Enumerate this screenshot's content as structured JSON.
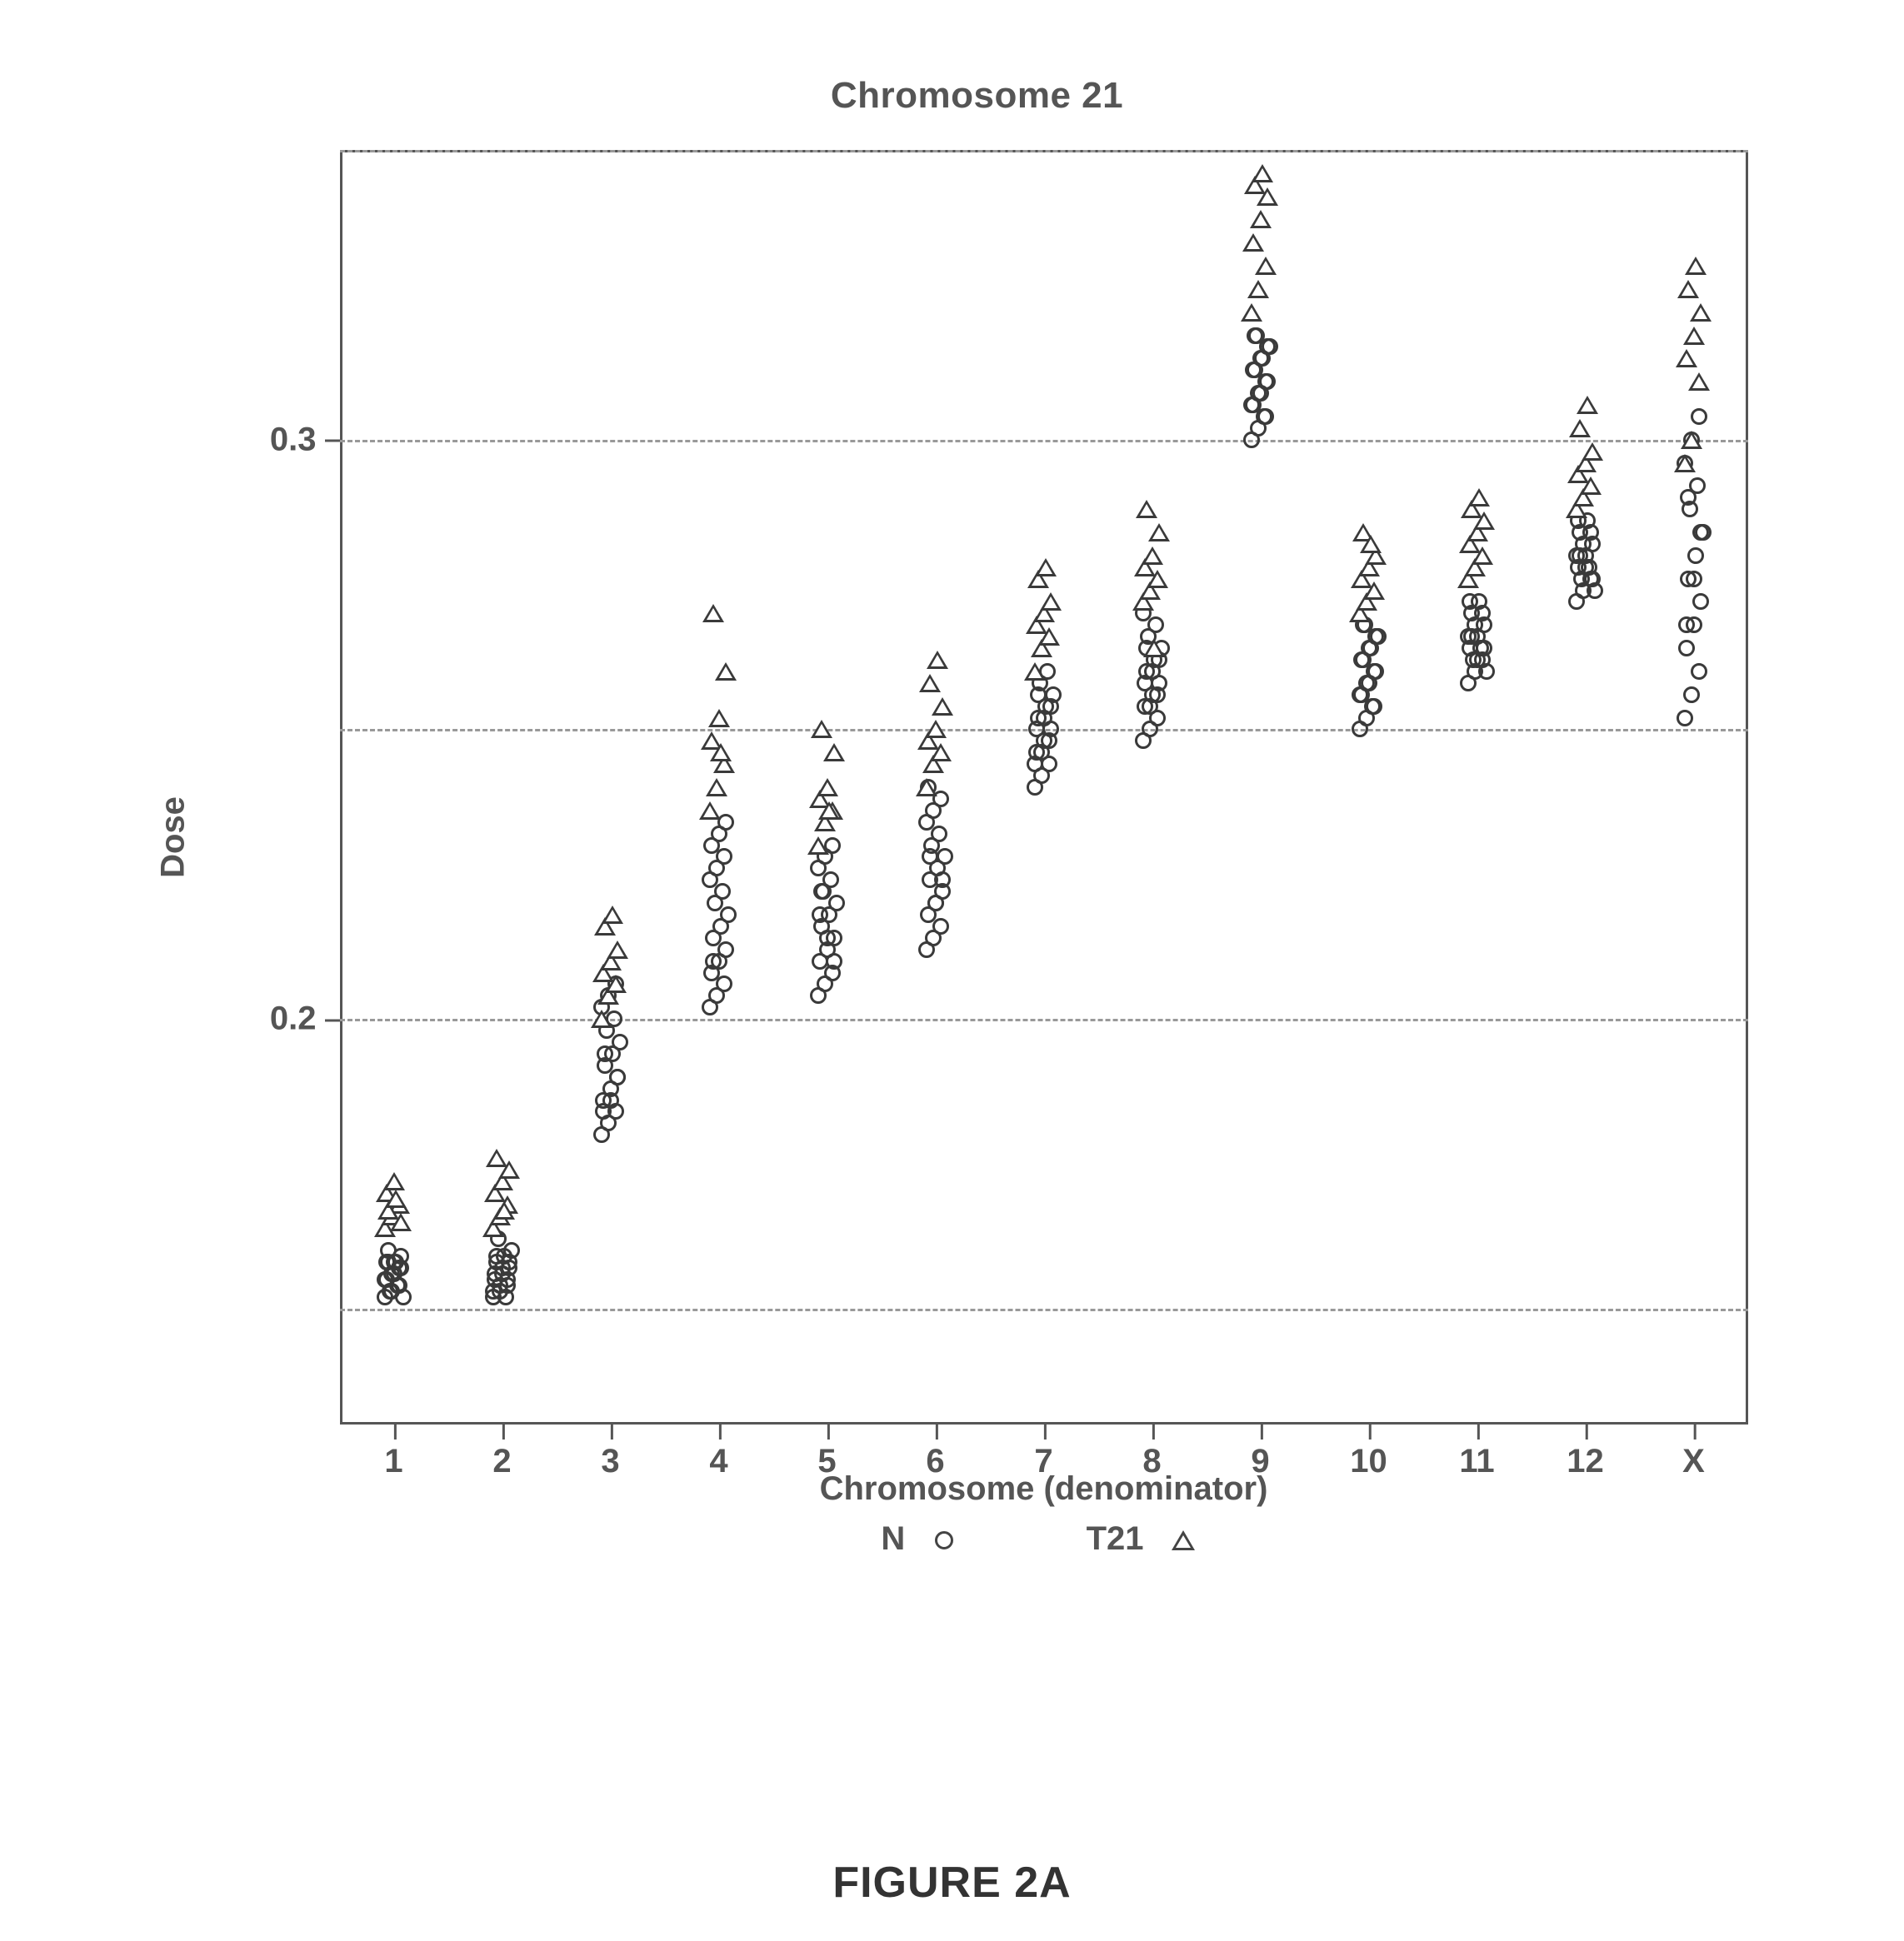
{
  "chart_data": {
    "type": "scatter",
    "title": "Chromosome 21",
    "xlabel": "Chromosome (denominator)",
    "ylabel": "Dose",
    "ylim": [
      0.13,
      0.35
    ],
    "y_gridlines": [
      0.15,
      0.2,
      0.25,
      0.3,
      0.35
    ],
    "y_ticks": [
      {
        "value": 0.2,
        "label": "0.2"
      },
      {
        "value": 0.3,
        "label": "0.3"
      }
    ],
    "categories": [
      "1",
      "2",
      "3",
      "4",
      "5",
      "6",
      "7",
      "8",
      "9",
      "10",
      "11",
      "12",
      "X"
    ],
    "series": [
      {
        "name": "N",
        "marker": "circle",
        "values_by_category": {
          "1": [
            0.152,
            0.153,
            0.154,
            0.155,
            0.156,
            0.157,
            0.158,
            0.158,
            0.152,
            0.153,
            0.154,
            0.155,
            0.156,
            0.157,
            0.158,
            0.158,
            0.159,
            0.16
          ],
          "2": [
            0.152,
            0.153,
            0.154,
            0.155,
            0.156,
            0.157,
            0.158,
            0.159,
            0.16,
            0.162,
            0.152,
            0.153,
            0.154,
            0.155,
            0.156,
            0.157,
            0.158,
            0.159
          ],
          "3": [
            0.18,
            0.182,
            0.184,
            0.186,
            0.188,
            0.19,
            0.192,
            0.194,
            0.196,
            0.198,
            0.2,
            0.202,
            0.204,
            0.206,
            0.184,
            0.186,
            0.19,
            0.194
          ],
          "4": [
            0.202,
            0.204,
            0.206,
            0.208,
            0.21,
            0.212,
            0.214,
            0.216,
            0.218,
            0.22,
            0.222,
            0.224,
            0.226,
            0.228,
            0.23,
            0.232,
            0.234,
            0.21
          ],
          "5": [
            0.204,
            0.206,
            0.208,
            0.21,
            0.212,
            0.214,
            0.216,
            0.218,
            0.22,
            0.222,
            0.224,
            0.226,
            0.228,
            0.23,
            0.218,
            0.214,
            0.21,
            0.222
          ],
          "6": [
            0.212,
            0.214,
            0.216,
            0.218,
            0.22,
            0.222,
            0.224,
            0.226,
            0.228,
            0.23,
            0.232,
            0.234,
            0.236,
            0.238,
            0.24,
            0.22,
            0.224,
            0.228
          ],
          "7": [
            0.24,
            0.242,
            0.244,
            0.246,
            0.248,
            0.25,
            0.252,
            0.254,
            0.256,
            0.258,
            0.26,
            0.244,
            0.246,
            0.248,
            0.25,
            0.252,
            0.254,
            0.256
          ],
          "8": [
            0.248,
            0.25,
            0.252,
            0.254,
            0.256,
            0.258,
            0.26,
            0.262,
            0.264,
            0.266,
            0.268,
            0.27,
            0.254,
            0.256,
            0.258,
            0.26,
            0.262,
            0.264
          ],
          "9": [
            0.3,
            0.302,
            0.304,
            0.306,
            0.308,
            0.31,
            0.312,
            0.314,
            0.316,
            0.318,
            0.304,
            0.306,
            0.308,
            0.31,
            0.312,
            0.314,
            0.316,
            0.318
          ],
          "10": [
            0.25,
            0.252,
            0.254,
            0.256,
            0.258,
            0.26,
            0.262,
            0.264,
            0.266,
            0.268,
            0.254,
            0.256,
            0.258,
            0.26,
            0.262,
            0.264,
            0.266,
            0.268
          ],
          "11": [
            0.258,
            0.26,
            0.262,
            0.264,
            0.266,
            0.268,
            0.27,
            0.272,
            0.26,
            0.262,
            0.264,
            0.266,
            0.268,
            0.27,
            0.272,
            0.262,
            0.264,
            0.266
          ],
          "12": [
            0.272,
            0.274,
            0.276,
            0.278,
            0.28,
            0.282,
            0.284,
            0.286,
            0.274,
            0.276,
            0.278,
            0.28,
            0.282,
            0.284,
            0.286,
            0.278,
            0.276,
            0.28
          ],
          "X": [
            0.252,
            0.256,
            0.26,
            0.264,
            0.268,
            0.272,
            0.276,
            0.28,
            0.284,
            0.288,
            0.292,
            0.296,
            0.3,
            0.304,
            0.268,
            0.276,
            0.284,
            0.29
          ]
        }
      },
      {
        "name": "T21",
        "marker": "triangle",
        "values_by_category": {
          "1": [
            0.164,
            0.166,
            0.168,
            0.17,
            0.172,
            0.165,
            0.167,
            0.169
          ],
          "2": [
            0.164,
            0.166,
            0.168,
            0.17,
            0.172,
            0.174,
            0.176,
            0.167
          ],
          "3": [
            0.2,
            0.204,
            0.206,
            0.208,
            0.21,
            0.212,
            0.216,
            0.218
          ],
          "4": [
            0.236,
            0.24,
            0.244,
            0.248,
            0.252,
            0.26,
            0.27,
            0.246
          ],
          "5": [
            0.23,
            0.234,
            0.236,
            0.238,
            0.24,
            0.246,
            0.25,
            0.236
          ],
          "6": [
            0.24,
            0.244,
            0.246,
            0.248,
            0.25,
            0.254,
            0.258,
            0.262
          ],
          "7": [
            0.26,
            0.264,
            0.266,
            0.268,
            0.27,
            0.272,
            0.276,
            0.278
          ],
          "8": [
            0.272,
            0.274,
            0.276,
            0.278,
            0.28,
            0.284,
            0.288,
            0.264
          ],
          "9": [
            0.322,
            0.326,
            0.33,
            0.334,
            0.338,
            0.342,
            0.344,
            0.346
          ],
          "10": [
            0.27,
            0.272,
            0.274,
            0.276,
            0.278,
            0.28,
            0.284,
            0.282
          ],
          "11": [
            0.276,
            0.278,
            0.28,
            0.282,
            0.284,
            0.286,
            0.288,
            0.29
          ],
          "12": [
            0.288,
            0.29,
            0.292,
            0.294,
            0.296,
            0.298,
            0.302,
            0.306
          ],
          "X": [
            0.296,
            0.3,
            0.31,
            0.314,
            0.318,
            0.322,
            0.326,
            0.33
          ]
        }
      }
    ],
    "legend": [
      {
        "label": "N",
        "marker": "circle"
      },
      {
        "label": "T21",
        "marker": "triangle"
      }
    ]
  },
  "figure_caption": "FIGURE 2A"
}
